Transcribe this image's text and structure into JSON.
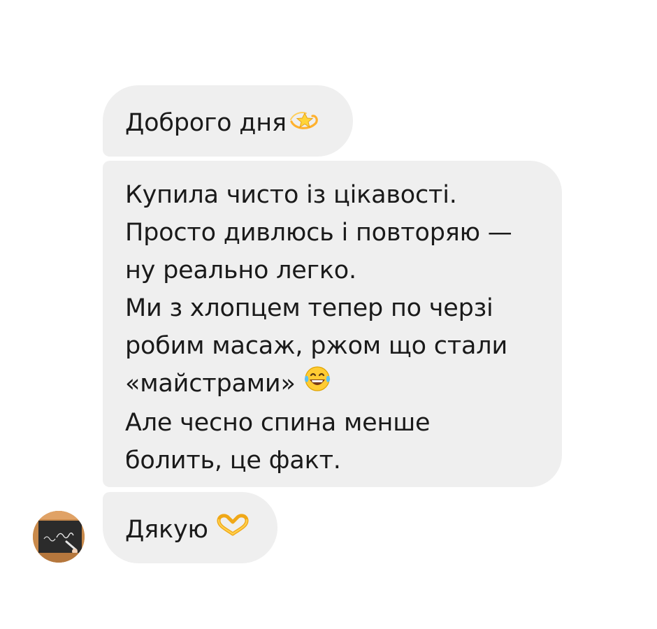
{
  "messages": [
    {
      "text": "Доброго дня",
      "emoji": "dizzy-star-emoji"
    },
    {
      "lines": [
        "Купила чисто із цікавості.",
        "Просто дивлюсь і повторяю —",
        "ну реально легко.",
        "Ми з хлопцем тепер по черзі",
        "робим масаж, ржом що стали",
        "«майстрами»",
        "Але чесно спина менше",
        "болить, це факт."
      ],
      "emoji": "tears-of-joy-emoji"
    },
    {
      "text": "Дякую",
      "emoji": "heart-hands-emoji"
    }
  ],
  "avatar": {
    "icon": "chalkboard-avatar",
    "colors": {
      "wood": "#c98a4b",
      "board": "#2b2b2b"
    }
  },
  "colors": {
    "bubble": "#efefef",
    "text": "#1a1a1a",
    "background": "#ffffff"
  }
}
